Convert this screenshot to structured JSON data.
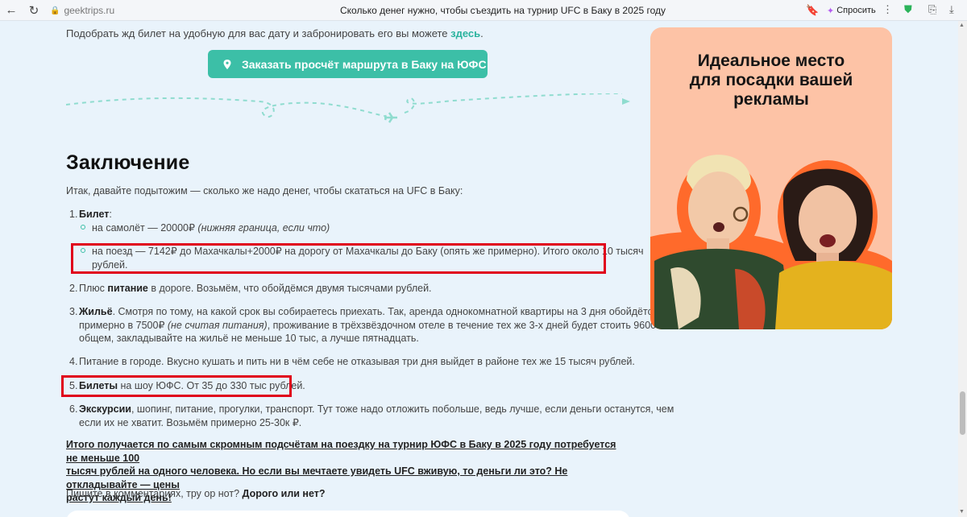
{
  "browser": {
    "domain": "geektrips.ru",
    "page_title": "Сколько денег нужно, чтобы съездить на турнир UFC в Баку в 2025 году",
    "ask_label": "Спросить",
    "ask_badge": "1"
  },
  "content": {
    "intro_text": "Подобрать жд билет на удобную для вас дату и забронировать его вы можете ",
    "intro_link": "здесь",
    "intro_end": ".",
    "cta_label": "Заказать просчёт маршрута в Баку  на ЮФС",
    "heading": "Заключение",
    "lead": "Итак, давайте подытожим — сколько же надо денег, чтобы скататься на UFC в Баку:",
    "items": [
      {
        "num": "1.",
        "bold": "Билет",
        "rest": ":"
      },
      {
        "num": "2.",
        "pre": "Плюс ",
        "bold": "питание",
        "rest": " в дороге. Возьмём, что обойдёмся двумя тысячами рублей."
      },
      {
        "num": "3.",
        "bold": "Жильё",
        "line1": ". Смотря по тому, на какой срок вы собираетесь приехать. Так, аренда однокомнатной квартиры на 3 дня обойдётся",
        "line2_pre": "примерно в 7500₽ ",
        "line2_italic": "(не считая питания)",
        "line2_post": ", проживание в трёхзвёздочном отеле в течение тех же 3-х дней будет стоить 9600₽. В",
        "line3": "общем, закладывайте на жильё не меньше 10 тыс, а лучше пятнадцать."
      },
      {
        "num": "4.",
        "rest": "Питание в городе. Вкусно кушать и пить ни в чём себе не отказывая три дня выйдет в районе тех же 15 тысяч рублей."
      },
      {
        "num": "5.",
        "bold": "Билеты",
        "rest": " на шоу ЮФС. От 35 до 330 тыс рублей."
      },
      {
        "num": "6.",
        "bold": "Экскурсии",
        "line1": ", шопинг, питание, прогулки, транспорт. Тут тоже надо отложить побольше, ведь лучше, если деньги останутся, чем",
        "line2": "если их не хватит. Возьмём примерно 25-30к ₽."
      }
    ],
    "sub_items": [
      {
        "text": "на самолёт — 20000₽ ",
        "italic": "(нижняя граница, если что)"
      },
      {
        "line1": "на поезд — 7142₽ до Махачкалы+2000₽ на дорогу от Махачкалы до Баку (опять же примерно). Итого около 10 тысяч",
        "line2": "рублей."
      }
    ],
    "conclusion": [
      "Итого получается по самым скромным подсчётам на поездку на турнир ЮФС в Баку в 2025 году потребуется не меньше 100",
      "тысяч рублей на одного человека. Но если вы мечтаете увидеть UFC вживую, то деньги ли это? Не откладывайте — цены",
      "растут каждый день!"
    ],
    "outro_pre": "Пишите в комментариях, тру ор нот? ",
    "outro_bold": "Дорого или нет?"
  },
  "ad": {
    "title_lines": [
      "Идеальное место",
      "для посадки вашей",
      "рекламы"
    ]
  },
  "colors": {
    "accent": "#3cbfa7",
    "highlight_box": "#e0001b",
    "ad_bg": "#fdc3a6"
  }
}
